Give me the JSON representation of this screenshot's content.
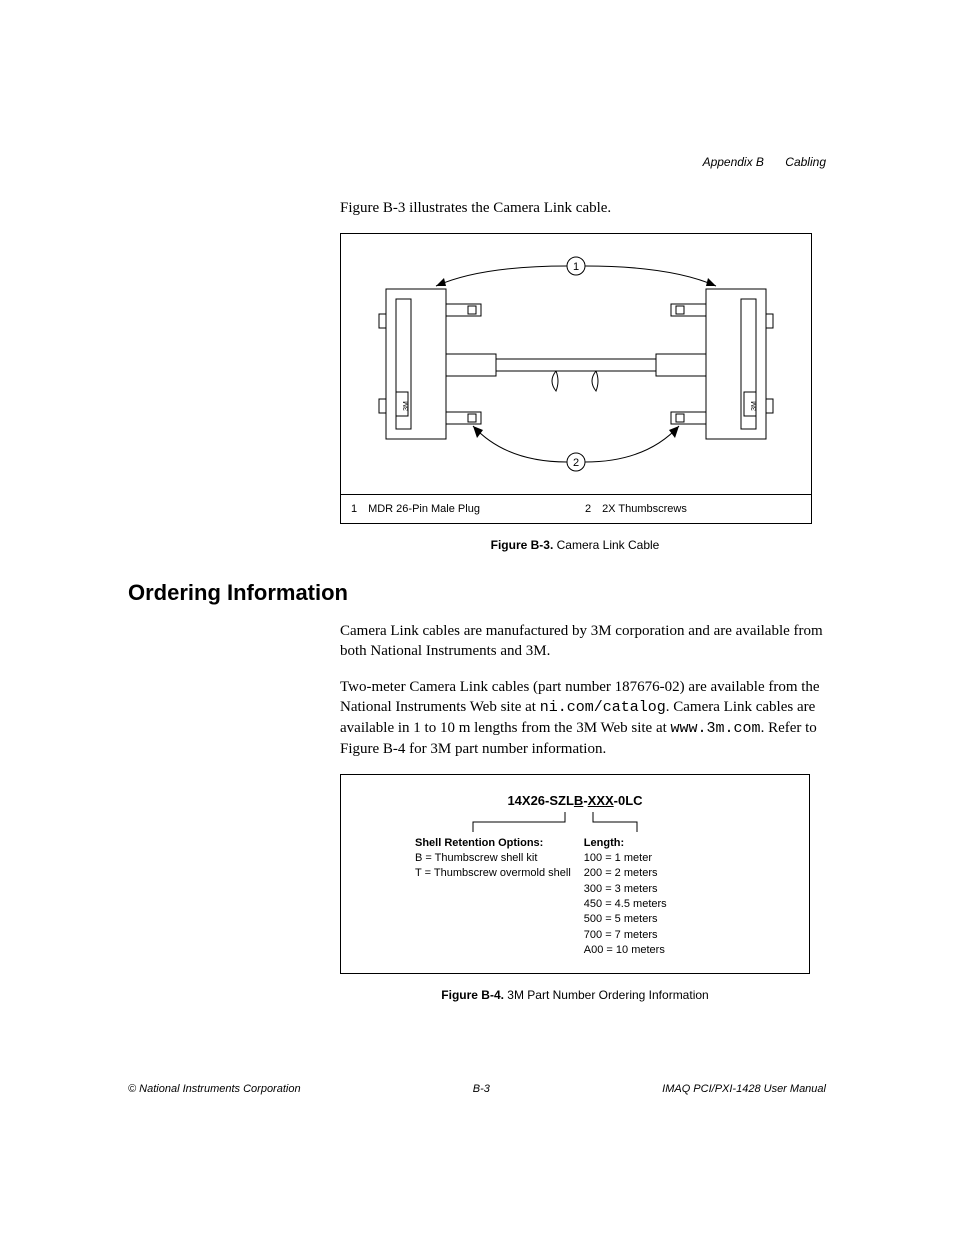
{
  "header": {
    "appendix": "Appendix B",
    "section": "Cabling"
  },
  "intro": "Figure B-3 illustrates the Camera Link cable.",
  "figureB3": {
    "callout1_num": "1",
    "callout2_num": "2",
    "legend1_num": "1",
    "legend1_text": "MDR 26-Pin Male Plug",
    "legend2_num": "2",
    "legend2_text": "2X Thumbscrews",
    "caption_num": "Figure B-3.  ",
    "caption_text": "Camera Link Cable",
    "connector_label": "3M"
  },
  "section_heading": "Ordering Information",
  "para1": "Camera Link cables are manufactured by 3M corporation and are available from both National Instruments and 3M.",
  "para2_a": "Two-meter Camera Link cables (part number 187676-02) are available from the National Instruments Web site at ",
  "para2_url1": "ni.com/catalog",
  "para2_b": ". Camera Link cables are available in 1 to 10 m lengths from the 3M Web site at ",
  "para2_url2": "www.3m.com",
  "para2_c": ". Refer to Figure B-4 for 3M part number information.",
  "figureB4": {
    "partnum_a": "14X26-SZL",
    "partnum_b": "B",
    "partnum_c": "-",
    "partnum_d": "XXX",
    "partnum_e": "-0LC",
    "left_head": "Shell Retention Options:",
    "left_l1": "B = Thumbscrew shell kit",
    "left_l2": "T = Thumbscrew overmold shell",
    "right_head": "Length:",
    "right_l1": "100 = 1 meter",
    "right_l2": "200 = 2 meters",
    "right_l3": "300 = 3 meters",
    "right_l4": "450 = 4.5 meters",
    "right_l5": "500 = 5 meters",
    "right_l6": "700 = 7 meters",
    "right_l7": "A00 = 10 meters",
    "caption_num": "Figure B-4.  ",
    "caption_text": "3M Part Number Ordering Information"
  },
  "footer": {
    "left": "© National Instruments Corporation",
    "center": "B-3",
    "right": "IMAQ PCI/PXI-1428 User Manual"
  },
  "chart_data": {
    "type": "table",
    "title": "3M Camera Link Cable Part Number 14X26-SZL{B|T}-XXX-0LC",
    "shell_retention_options": {
      "B": "Thumbscrew shell kit",
      "T": "Thumbscrew overmold shell"
    },
    "length_codes": {
      "100": 1,
      "200": 2,
      "300": 3,
      "450": 4.5,
      "500": 5,
      "700": 7,
      "A00": 10
    },
    "length_unit": "meters"
  }
}
